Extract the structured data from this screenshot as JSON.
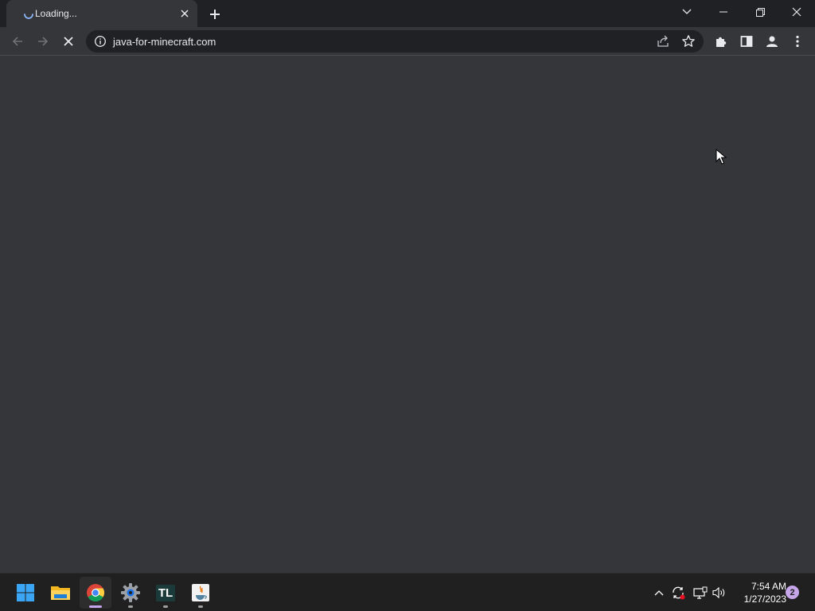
{
  "browser": {
    "tab": {
      "title": "Loading...",
      "icons": {
        "status": "loading-spinner-icon",
        "close": "close-icon"
      }
    },
    "new_tab_icon": "plus-icon",
    "window_controls": [
      "chevron-down-icon",
      "minimize-icon",
      "restore-icon",
      "close-icon"
    ],
    "toolbar": {
      "back_icon": "arrow-left-icon",
      "forward_icon": "arrow-right-icon",
      "stop_icon": "close-icon",
      "url": "java-for-minecraft.com",
      "site_info_icon": "info-icon",
      "share_icon": "share-icon",
      "bookmark_icon": "star-icon",
      "extensions_icon": "puzzle-icon",
      "side_panel_icon": "side-panel-icon",
      "profile_icon": "person-icon",
      "menu_icon": "kebab-menu-icon"
    }
  },
  "taskbar": {
    "apps": [
      {
        "name": "Start",
        "icon": "windows-icon"
      },
      {
        "name": "File Explorer",
        "icon": "folder-icon"
      },
      {
        "name": "Google Chrome",
        "icon": "chrome-icon",
        "active": true
      },
      {
        "name": "Settings",
        "icon": "gear-icon"
      },
      {
        "name": "TL",
        "icon": "tl-icon",
        "label": "TL"
      },
      {
        "name": "Java",
        "icon": "java-icon"
      }
    ],
    "tray": [
      "chevron-up-icon",
      "sync-icon",
      "network-icon",
      "volume-icon"
    ],
    "clock": {
      "time": "7:54 AM",
      "date": "1/27/2023"
    },
    "notification_count": "2"
  },
  "colors": {
    "tabstrip": "#202124",
    "toolbar": "#35363a",
    "omnibox": "#202124",
    "taskbar": "#202020",
    "accent_indicator": "#c6a6e8"
  }
}
